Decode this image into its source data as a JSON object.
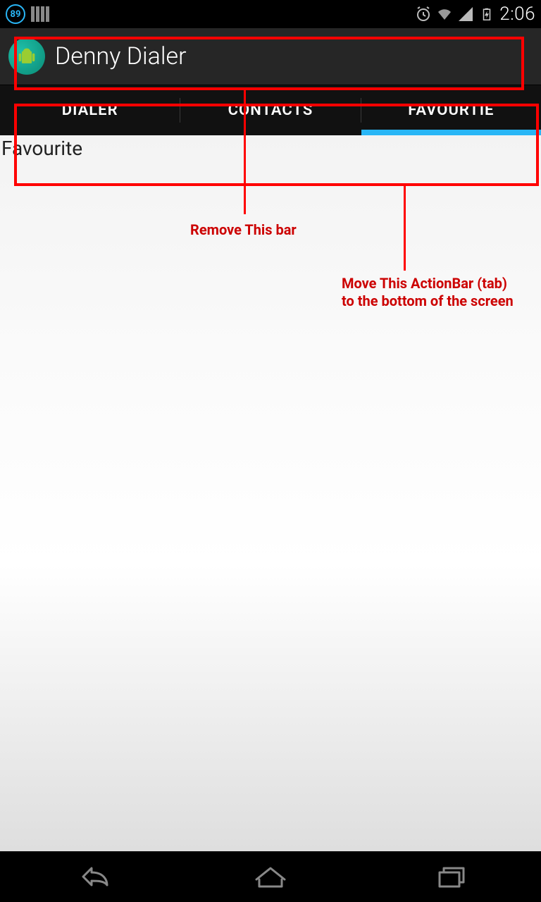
{
  "status": {
    "battery_pct": "89",
    "time": "2:06"
  },
  "actionbar": {
    "title": "Denny Dialer"
  },
  "tabs": {
    "t0": "DIALER",
    "t1": "CONTACTS",
    "t2": "FAVOURTIE"
  },
  "content": {
    "label": "Favourite"
  },
  "annotations": {
    "remove_bar": "Remove This bar",
    "move_tab_l1": "Move This ActionBar (tab)",
    "move_tab_l2": "to the bottom of the screen"
  }
}
